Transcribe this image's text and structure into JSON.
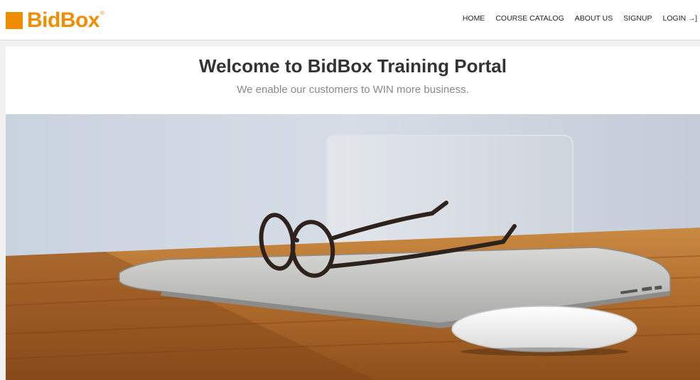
{
  "header": {
    "logo_text": "BidBox",
    "logo_reg": "®",
    "nav": [
      {
        "label": "HOME"
      },
      {
        "label": "COURSE CATALOG"
      },
      {
        "label": "ABOUT US"
      },
      {
        "label": "SIGNUP"
      },
      {
        "label": "LOGIN"
      }
    ],
    "login_icon": "→]"
  },
  "main": {
    "title": "Welcome to BidBox Training Portal",
    "subtitle": "We enable our customers to WIN more business."
  },
  "icons": {
    "login": "login-icon"
  },
  "colors": {
    "brand": "#f08c00",
    "title": "#333333",
    "subtitle": "#888888"
  }
}
